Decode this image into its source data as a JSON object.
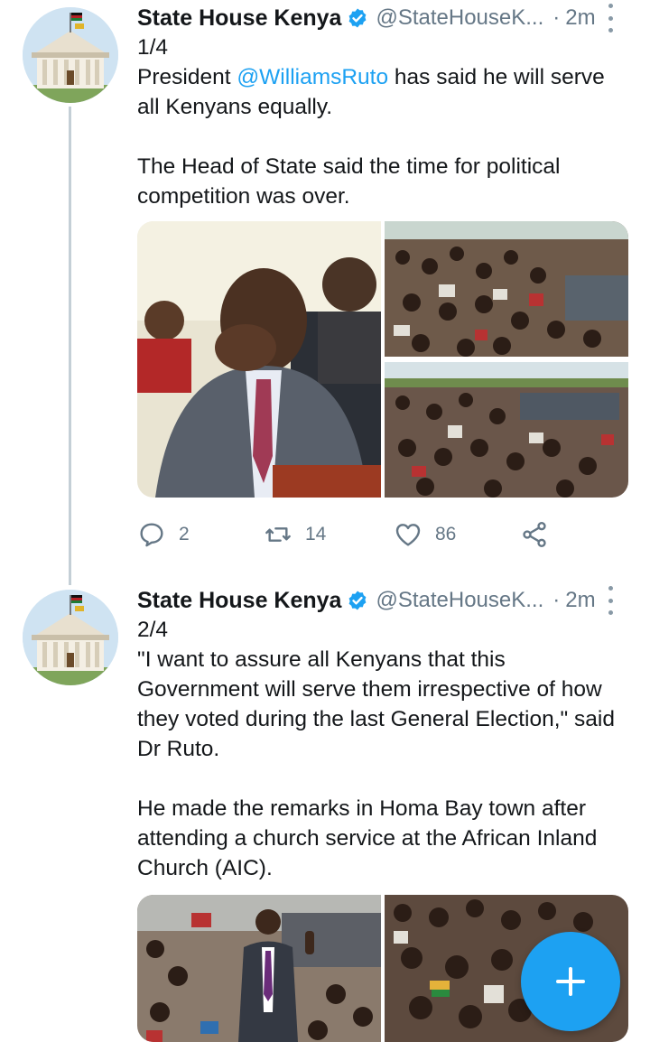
{
  "tweets": [
    {
      "author_name": "State House Kenya",
      "handle": "@StateHouseK...",
      "separator": "·",
      "time": "2m",
      "thread_index": "1/4",
      "text_pre": "President ",
      "mention": "@WilliamsRuto",
      "text_post": " has said he will serve all Kenyans equally.",
      "paragraph2": "The Head of State said the time for political competition was over.",
      "media": [
        "president-laughing-photo",
        "crowd-photo-1",
        "crowd-photo-2"
      ],
      "replies": "2",
      "retweets": "14",
      "likes": "86"
    },
    {
      "author_name": "State House Kenya",
      "handle": "@StateHouseK...",
      "separator": "·",
      "time": "2m",
      "thread_index": "2/4",
      "paragraph1": "\"I want to assure all Kenyans that this Government will serve them irrespective of how they voted during the last General Election,\" said Dr Ruto.",
      "paragraph2": "He made the remarks in Homa Bay town after attending a church service at the African Inland Church (AIC).",
      "media": [
        "president-speaking-photo",
        "crowd-photo-3"
      ]
    }
  ],
  "icons": {
    "verified": "verified-badge-icon",
    "more": "more-vertical-icon",
    "reply": "reply-icon",
    "retweet": "retweet-icon",
    "like": "heart-icon",
    "share": "share-icon",
    "compose": "plus-icon"
  },
  "colors": {
    "accent": "#1da1f2",
    "secondary_text": "#657786",
    "thread_line": "#c4cfd6"
  }
}
